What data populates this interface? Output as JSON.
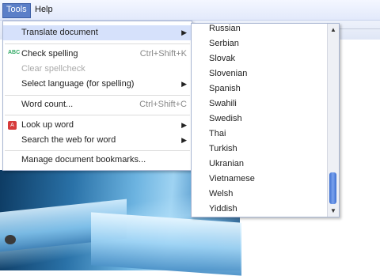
{
  "menubar": {
    "tools_label": "Tools",
    "help_label": "Help"
  },
  "tools_menu": {
    "items": [
      {
        "label": "Translate document",
        "submenu": true,
        "highlighted": true
      },
      {
        "label": "Check spelling",
        "shortcut": "Ctrl+Shift+K",
        "icon": "spellcheck-icon"
      },
      {
        "label": "Clear spellcheck",
        "disabled": true
      },
      {
        "label": "Select language (for spelling)",
        "submenu": true
      },
      {
        "label": "Word count...",
        "shortcut": "Ctrl+Shift+C"
      },
      {
        "label": "Look up word",
        "submenu": true,
        "icon": "dictionary-icon"
      },
      {
        "label": "Search the web for word",
        "submenu": true
      },
      {
        "label": "Manage document bookmarks..."
      }
    ],
    "submenu_arrow": "▶",
    "spellcheck_icon_text": "ABC",
    "lookup_icon_text": "A"
  },
  "language_submenu": {
    "languages": [
      "Russian",
      "Serbian",
      "Slovak",
      "Slovenian",
      "Spanish",
      "Swahili",
      "Swedish",
      "Thai",
      "Turkish",
      "Ukranian",
      "Vietnamese",
      "Welsh",
      "Yiddish"
    ],
    "scroll_up": "▲",
    "scroll_down": "▼"
  }
}
